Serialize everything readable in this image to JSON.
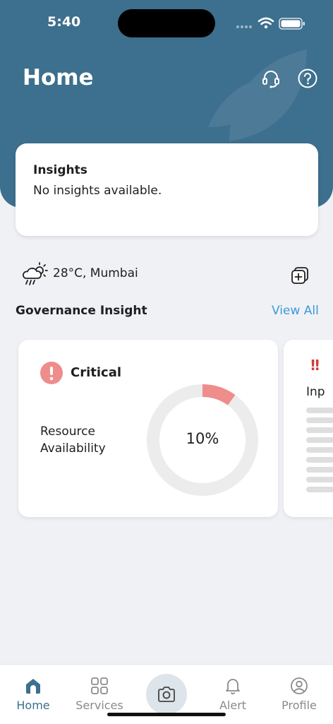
{
  "status_bar": {
    "time": "5:40"
  },
  "header": {
    "title": "Home",
    "icons": {
      "support": "headset-icon",
      "help": "help-icon"
    },
    "color": "#3d6f8e"
  },
  "insights": {
    "title": "Insights",
    "message": "No insights available."
  },
  "weather": {
    "text": "28°C, Mumbai",
    "icon": "weather-rain-icon"
  },
  "governance": {
    "title": "Governance Insight",
    "view_all": "View All",
    "cards": [
      {
        "status": "Critical",
        "metric": "Resource Availability",
        "value": "10%",
        "percent": 10,
        "ring_color": "#ef8c8c",
        "track_color": "#ececec"
      },
      {
        "label_partial": "Inp"
      }
    ]
  },
  "tabs": [
    {
      "label": "Home",
      "icon": "home-icon",
      "active": true
    },
    {
      "label": "Services",
      "icon": "grid-icon",
      "active": false
    },
    {
      "label": "",
      "icon": "camera-icon",
      "active": false
    },
    {
      "label": "Alert",
      "icon": "bell-icon",
      "active": false
    },
    {
      "label": "Profile",
      "icon": "user-circle-icon",
      "active": false
    }
  ],
  "colors": {
    "accent": "#3a9ad9",
    "critical": "#ef8c8c",
    "brand": "#3d6f8e"
  }
}
